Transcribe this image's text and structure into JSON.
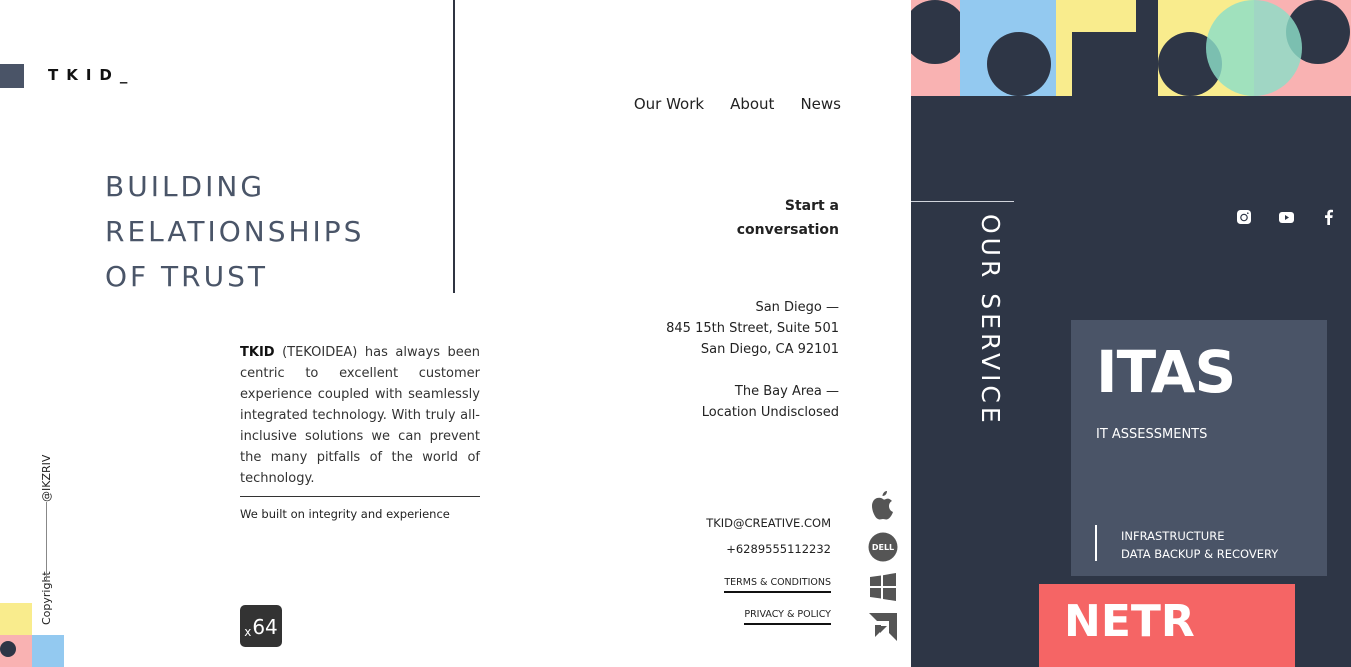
{
  "brand": {
    "logo_text": "TKID_"
  },
  "nav": {
    "items": [
      "Our Work",
      "About",
      "News"
    ]
  },
  "hero": {
    "lines": [
      "BUILDING",
      "RELATIONSHIPS",
      "OF TRUST"
    ]
  },
  "about": {
    "brand_bold": "TKID",
    "body": " (TEKOIDEA) has always been centric to excellent customer experience coupled with seamlessly integrated technology. With truly all-inclusive solutions we can prevent the many pitfalls of the world of technology.",
    "tagline": "We built on integrity and experience"
  },
  "copyright": {
    "label": "Copyright",
    "handle": "@IKZRIV"
  },
  "badge": {
    "prefix": "x",
    "value": "64"
  },
  "contact": {
    "cta_line1": "Start a",
    "cta_line2": "conversation",
    "office1": [
      "San Diego —",
      "845 15th Street, Suite 501",
      "San Diego, CA 92101"
    ],
    "office2": [
      "The Bay Area —",
      "Location Undisclosed"
    ],
    "email": "TKID@CREATIVE.COM",
    "phone": "+6289555112232",
    "terms": "TERMS & CONDITIONS",
    "privacy": "PRIVACY & POLICY"
  },
  "partners": [
    "apple-icon",
    "dell-icon",
    "windows-icon",
    "amd-icon"
  ],
  "services": {
    "heading": "OUR SERVICE",
    "social": [
      "instagram-icon",
      "youtube-icon",
      "facebook-icon"
    ],
    "cards": [
      {
        "title": "ITAS",
        "subtitle": "IT ASSESSMENTS",
        "items": [
          "INFRASTRUCTURE",
          "DATA BACKUP & RECOVERY"
        ]
      },
      {
        "title": "NETR"
      }
    ]
  },
  "colors": {
    "dark": "#2e3646",
    "slate": "#4a5467",
    "coral": "#f56565",
    "pink": "#f9b2b2",
    "yellow": "#f9ec8d",
    "blue": "#93c9f0",
    "mint": "#9ae6c6"
  }
}
